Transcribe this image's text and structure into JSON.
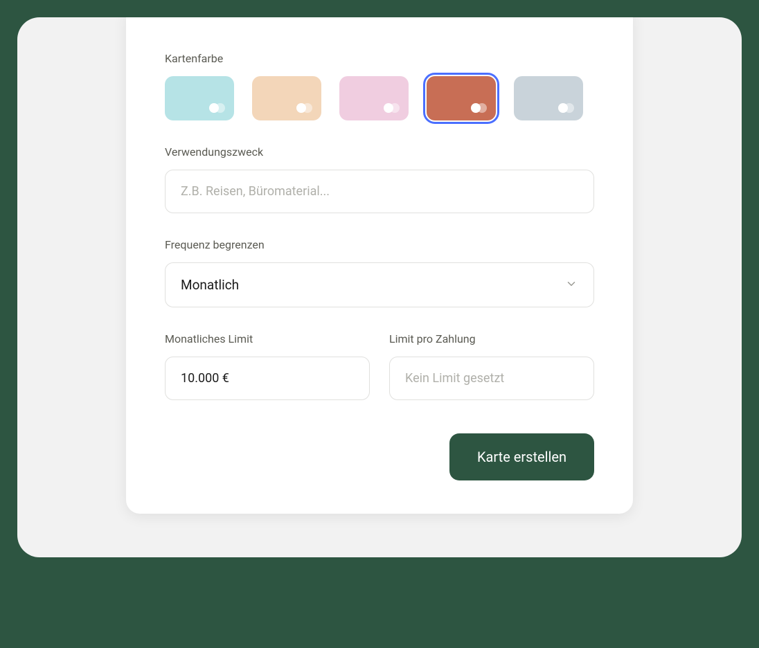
{
  "labels": {
    "cardColor": "Kartenfarbe",
    "purpose": "Verwendungszweck",
    "frequency": "Frequenz begrenzen",
    "monthlyLimit": "Monatliches Limit",
    "perPaymentLimit": "Limit pro Zahlung"
  },
  "colors": {
    "options": [
      {
        "name": "light-blue",
        "hex": "#b6e3e6",
        "selected": false
      },
      {
        "name": "peach",
        "hex": "#f3d6b9",
        "selected": false
      },
      {
        "name": "pink",
        "hex": "#f0cde0",
        "selected": false
      },
      {
        "name": "terracotta",
        "hex": "#c86e55",
        "selected": true
      },
      {
        "name": "gray-blue",
        "hex": "#c9d3da",
        "selected": false
      }
    ]
  },
  "purposeInput": {
    "value": "",
    "placeholder": "Z.B. Reisen, Büromaterial..."
  },
  "frequencySelect": {
    "selected": "Monatlich"
  },
  "monthlyLimitInput": {
    "value": "10.000 €"
  },
  "perPaymentLimitInput": {
    "value": "",
    "placeholder": "Kein Limit gesetzt"
  },
  "submitButton": {
    "label": "Karte erstellen"
  },
  "accentColor": "#4b6fff",
  "primaryColor": "#2d5541"
}
